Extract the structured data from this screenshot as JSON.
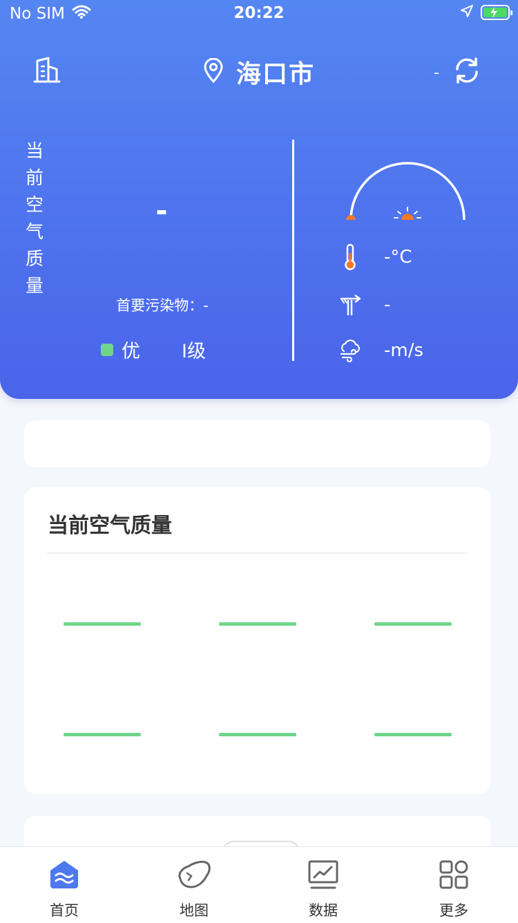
{
  "status_bar": {
    "carrier": "No SIM",
    "time": "20:22"
  },
  "header": {
    "city": "海口市",
    "update_value": "-",
    "vertical_label": [
      "当",
      "前",
      "空",
      "气",
      "质",
      "量"
    ],
    "aqi_value": "-",
    "primary_pollutant": "首要污染物：-",
    "quality_text": "优",
    "quality_grade": "I级",
    "quality_color": "#6fd58b",
    "temperature": "-°C",
    "wind_direction": "-",
    "wind_speed": "-m/s"
  },
  "air_quality_card": {
    "title": "当前空气质量",
    "metric_color": "#6fd58b"
  },
  "tabbar": {
    "tabs": [
      {
        "label": "首页",
        "icon": "home-icon"
      },
      {
        "label": "地图",
        "icon": "map-icon"
      },
      {
        "label": "数据",
        "icon": "chart-icon"
      },
      {
        "label": "更多",
        "icon": "grid-icon"
      }
    ]
  },
  "colors": {
    "header_gradient_top": "#5486f2",
    "header_gradient_bottom": "#4a64ea",
    "accent": "#4d78ee",
    "sun": "#f47a28"
  }
}
